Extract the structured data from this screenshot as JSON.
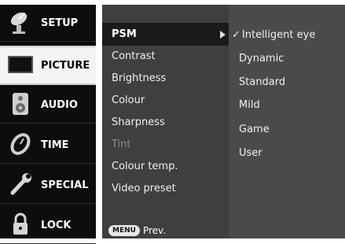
{
  "categories": [
    {
      "label": "SETUP",
      "icon": "satellite-dish-icon"
    },
    {
      "label": "PICTURE",
      "icon": "tv-screen-icon"
    },
    {
      "label": "AUDIO",
      "icon": "speaker-icon"
    },
    {
      "label": "TIME",
      "icon": "clock-icon"
    },
    {
      "label": "SPECIAL",
      "icon": "wrench-icon"
    },
    {
      "label": "LOCK",
      "icon": "padlock-icon"
    }
  ],
  "selected_category": "PICTURE",
  "submenu": {
    "items": [
      {
        "label": "PSM",
        "selected": true,
        "has_arrow": true
      },
      {
        "label": "Contrast"
      },
      {
        "label": "Brightness"
      },
      {
        "label": "Colour"
      },
      {
        "label": "Sharpness"
      },
      {
        "label": "Tint",
        "disabled": true
      },
      {
        "label": "Colour temp."
      },
      {
        "label": "Video preset"
      }
    ],
    "footer_button": "MENU",
    "footer_label": "Prev."
  },
  "options": {
    "items": [
      {
        "label": "Intelligent eye",
        "selected": true,
        "check": "✓"
      },
      {
        "label": "Dynamic"
      },
      {
        "label": "Standard"
      },
      {
        "label": "Mild"
      },
      {
        "label": "Game"
      },
      {
        "label": "User"
      }
    ]
  },
  "colors": {
    "menu_black": "#0d0d0d",
    "submenu_gray": "#3f3f3f",
    "options_gray": "#4a4a4a",
    "selected_bg": "#f4f4f4",
    "disabled_text": "#8c8c8c"
  }
}
